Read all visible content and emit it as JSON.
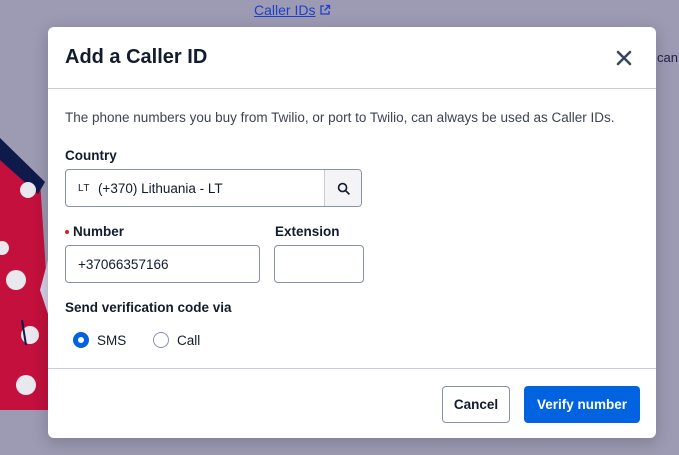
{
  "background": {
    "link_text": "Caller IDs",
    "side_text": "can"
  },
  "modal": {
    "title": "Add a Caller ID",
    "intro": "The phone numbers you buy from Twilio, or port to Twilio, can always be used as Caller IDs.",
    "country": {
      "label": "Country",
      "code": "LT",
      "value": "(+370) Lithuania - LT"
    },
    "number": {
      "label": "Number",
      "value": "+37066357166"
    },
    "extension": {
      "label": "Extension",
      "value": ""
    },
    "verification": {
      "label": "Send verification code via",
      "options": [
        {
          "label": "SMS",
          "selected": true
        },
        {
          "label": "Call",
          "selected": false
        }
      ]
    },
    "footer": {
      "cancel_label": "Cancel",
      "verify_label": "Verify number"
    }
  },
  "colors": {
    "primary": "#0263e0",
    "required": "#d61f1f",
    "overlay": "#9d9bb3"
  }
}
